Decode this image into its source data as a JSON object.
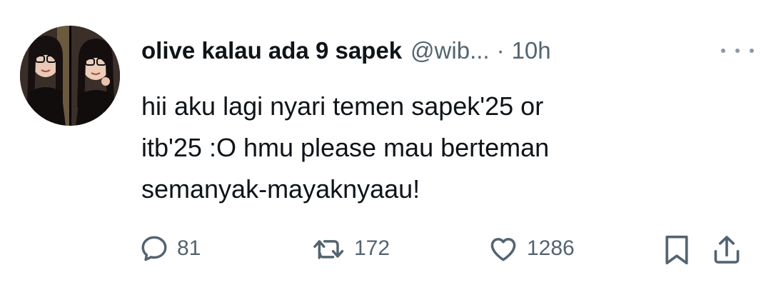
{
  "tweet": {
    "author": {
      "display_name": "olive kalau ada 9 sapek",
      "handle": "@wib...",
      "avatar_icon": "profile-photo"
    },
    "separator": "·",
    "timestamp": "10h",
    "text_lines": [
      "hii aku lagi nyari temen sapek'25 or",
      "itb'25 :O hmu please mau berteman",
      "semanyak-mayaknyaau!"
    ],
    "actions": {
      "reply": {
        "icon": "reply-icon",
        "count": "81"
      },
      "retweet": {
        "icon": "retweet-icon",
        "count": "172"
      },
      "like": {
        "icon": "heart-icon",
        "count": "1286"
      },
      "bookmark": {
        "icon": "bookmark-icon"
      },
      "share": {
        "icon": "share-icon"
      }
    },
    "more_icon": "more-icon"
  },
  "colors": {
    "text_primary": "#0f1419",
    "text_secondary": "#536471",
    "background": "#ffffff"
  }
}
